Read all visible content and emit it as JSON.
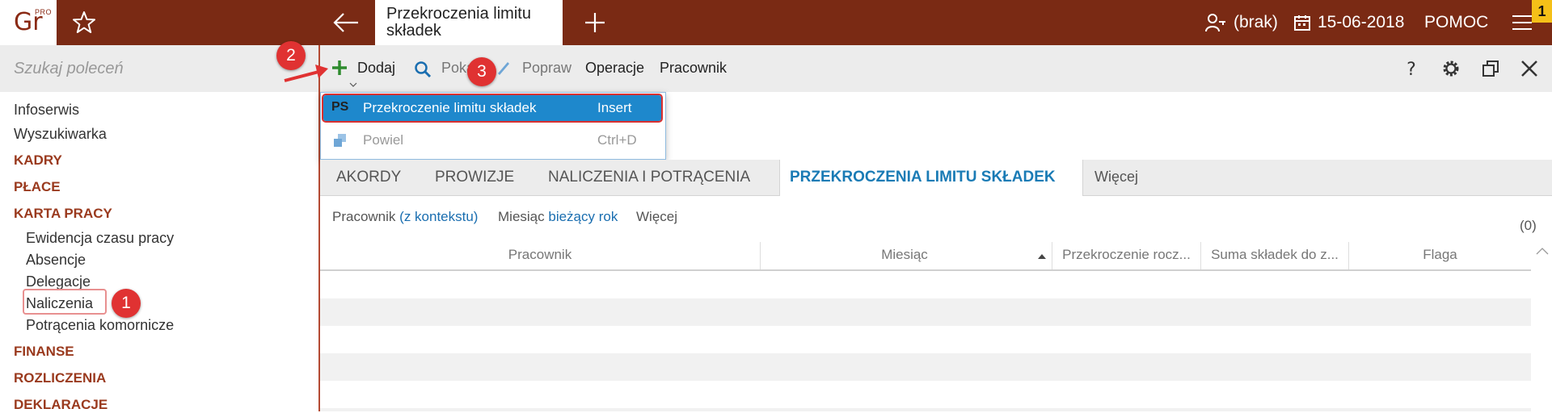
{
  "app": {
    "logo_text": "Gr",
    "logo_sup": "PRO"
  },
  "header": {
    "tab_title": "Przekroczenia limitu składek",
    "user": "(brak)",
    "date": "15-06-2018",
    "help": "POMOC",
    "notification_count": "1"
  },
  "sidebar": {
    "search_placeholder": "Szukaj poleceń",
    "items": [
      {
        "label": "Infoserwis"
      },
      {
        "label": "Wyszukiwarka"
      }
    ],
    "sections": [
      {
        "label": "KADRY"
      },
      {
        "label": "PŁACE"
      },
      {
        "label": "KARTA PRACY"
      },
      {
        "label": "FINANSE"
      },
      {
        "label": "ROZLICZENIA"
      },
      {
        "label": "DEKLARACJE"
      }
    ],
    "karta_pracy_items": [
      {
        "label": "Ewidencja czasu pracy"
      },
      {
        "label": "Absencje"
      },
      {
        "label": "Delegacje"
      },
      {
        "label": "Naliczenia"
      },
      {
        "label": "Potrącenia komornicze"
      }
    ]
  },
  "toolbar": {
    "add": "Dodaj",
    "show": "Pokaż",
    "edit": "Popraw",
    "operations": "Operacje",
    "employee": "Pracownik"
  },
  "dropdown": {
    "items": [
      {
        "badge": "PS",
        "label": "Przekroczenie limitu składek",
        "shortcut": "Insert"
      },
      {
        "label": "Powiel",
        "shortcut": "Ctrl+D"
      }
    ]
  },
  "tabs": [
    {
      "label": "AKORDY"
    },
    {
      "label": "PROWIZJE"
    },
    {
      "label": "NALICZENIA I POTRĄCENIA"
    },
    {
      "label": "PRZEKROCZENIA LIMITU SKŁADEK"
    },
    {
      "label": "Więcej"
    }
  ],
  "filters": {
    "employee_label": "Pracownik",
    "employee_value": "(z kontekstu)",
    "month_label": "Miesiąc",
    "month_value": "bieżący rok",
    "more": "Więcej",
    "count": "(0)"
  },
  "grid": {
    "columns": [
      {
        "label": "Pracownik"
      },
      {
        "label": "Miesiąc"
      },
      {
        "label": "Przekroczenie rocz..."
      },
      {
        "label": "Suma składek do z..."
      },
      {
        "label": "Flaga"
      }
    ]
  },
  "annotations": {
    "c1": "1",
    "c2": "2",
    "c3": "3"
  },
  "colors": {
    "brand": "#7a2a14",
    "accent": "#1a7bb5",
    "highlight": "#1e88cc",
    "callout": "#e03232"
  }
}
